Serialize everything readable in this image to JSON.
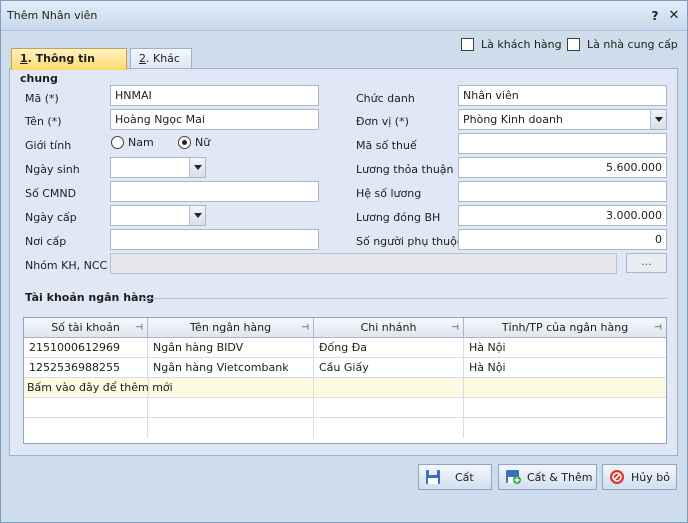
{
  "window": {
    "title": "Thêm Nhân viên",
    "help": "?",
    "close": "✕"
  },
  "top_checks": [
    {
      "label": "Là khách hàng",
      "checked": false
    },
    {
      "label": "Là nhà cung cấp",
      "checked": false
    }
  ],
  "tabs": [
    {
      "key": "1",
      "label": ". Thông tin chung",
      "active": true
    },
    {
      "key": "2",
      "label": ". Khác",
      "active": false
    }
  ],
  "form": {
    "ma": {
      "label": "Mã (*)",
      "value": "HNMAI"
    },
    "ten": {
      "label": "Tên (*)",
      "value": "Hoàng Ngọc Mai"
    },
    "gioi_tinh": {
      "label": "Giới tính",
      "options": [
        "Nam",
        "Nữ"
      ],
      "selected": "Nữ"
    },
    "ngay_sinh": {
      "label": "Ngày sinh",
      "value": ""
    },
    "so_cmnd": {
      "label": "Số CMND",
      "value": ""
    },
    "ngay_cap": {
      "label": "Ngày cấp",
      "value": ""
    },
    "noi_cap": {
      "label": "Nơi cấp",
      "value": ""
    },
    "nhom_kh": {
      "label": "Nhóm KH, NCC",
      "value": "",
      "button": "..."
    },
    "chuc_danh": {
      "label": "Chức danh",
      "value": "Nhân viên"
    },
    "don_vi": {
      "label": "Đơn vị (*)",
      "value": "Phòng Kinh doanh"
    },
    "ma_so_thue": {
      "label": "Mã số thuế",
      "value": ""
    },
    "luong_thoa_thuan": {
      "label": "Lương thỏa thuận",
      "value": "5.600.000"
    },
    "he_so_luong": {
      "label": "Hệ số lương",
      "value": ""
    },
    "luong_dong_bh": {
      "label": "Lương đóng BH",
      "value": "3.000.000"
    },
    "so_nguoi_phu_thuoc": {
      "label": "Số người phụ thuộc",
      "value": "0"
    }
  },
  "bank": {
    "section_title": "Tài khoản ngân hàng",
    "columns": [
      "Số tài khoản",
      "Tên ngân hàng",
      "Chi nhánh",
      "Tỉnh/TP của ngân hàng"
    ],
    "pin": "⊣",
    "rows": [
      [
        "2151000612969",
        "Ngân hàng BIDV",
        "Đống Đa",
        "Hà Nội"
      ],
      [
        "1252536988255",
        "Ngân hàng Vietcombank",
        "Cầu Giấy",
        "Hà Nội"
      ]
    ],
    "new_row_hint": "Bấm vào đây để thêm mới"
  },
  "buttons": {
    "save": "Cất",
    "save_add": "Cất & Thêm",
    "cancel": "Hủy bỏ"
  },
  "colors": {
    "tab_active": "#ffd86b",
    "panel": "#dfe8f4",
    "new_row": "#fffbe2"
  }
}
